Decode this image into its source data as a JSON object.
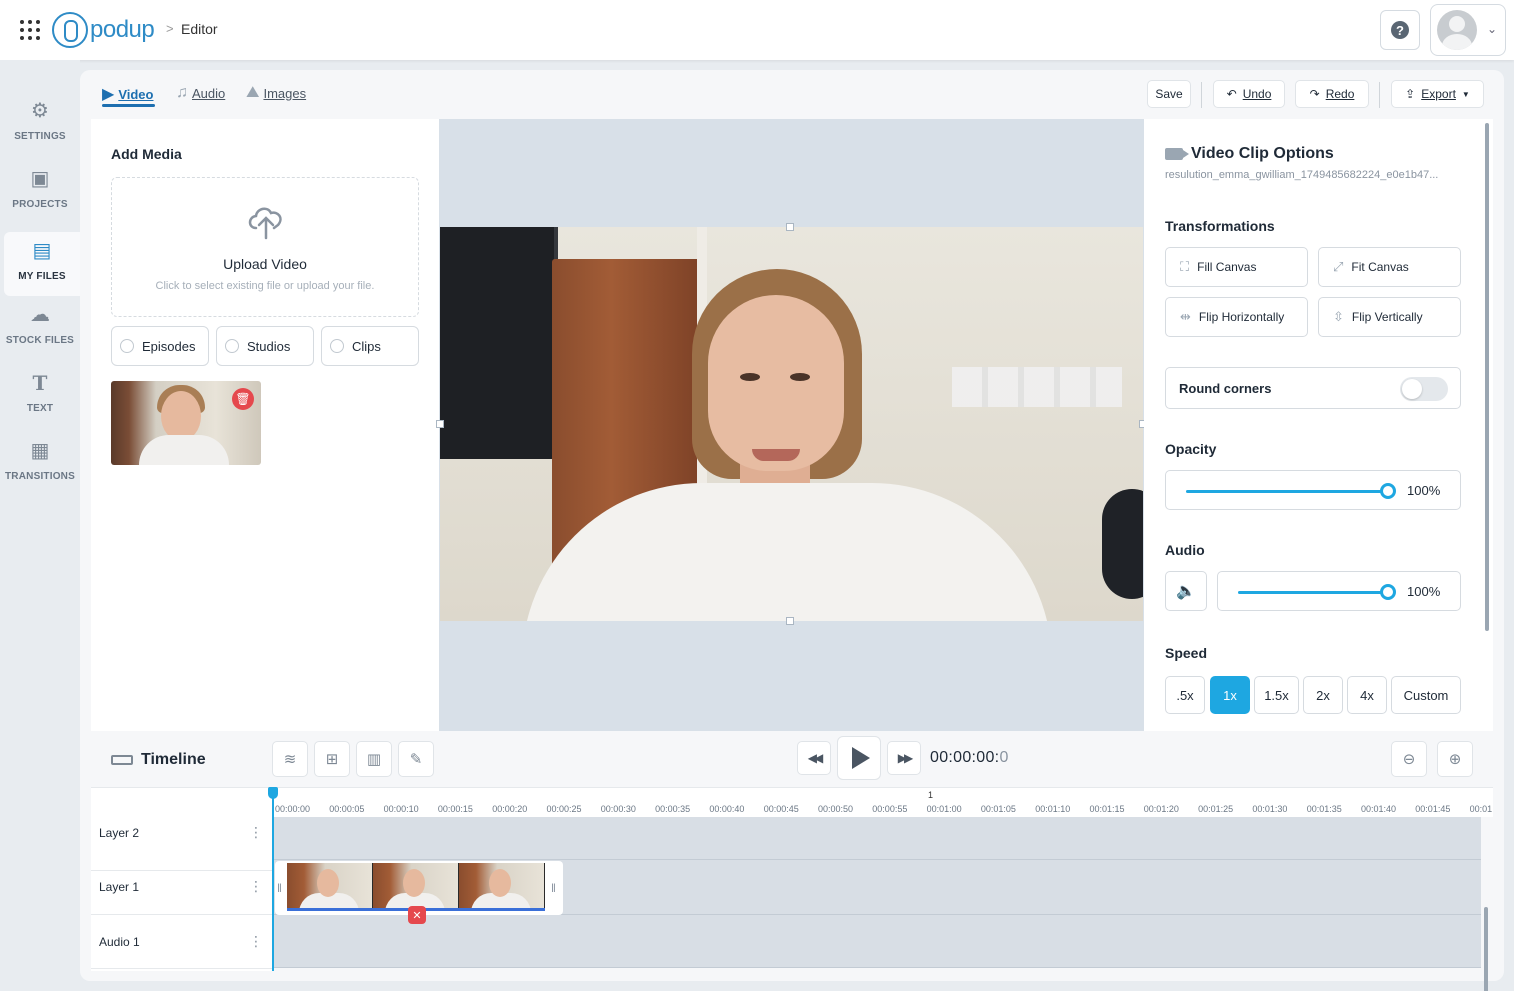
{
  "header": {
    "logo_text": "podup",
    "breadcrumb_sep": ">",
    "breadcrumb": "Editor",
    "help_label": "?"
  },
  "leftnav": {
    "items": [
      {
        "label": "SETTINGS",
        "icon": "gear-icon",
        "glyph": "⚙"
      },
      {
        "label": "PROJECTS",
        "icon": "projects-icon",
        "glyph": "▣"
      },
      {
        "label": "MY FILES",
        "icon": "folder-icon",
        "glyph": "▤",
        "active": true
      },
      {
        "label": "STOCK FILES",
        "icon": "cloud-icon",
        "glyph": "☁"
      },
      {
        "label": "TEXT",
        "icon": "text-icon",
        "glyph": "T"
      },
      {
        "label": "TRANSITIONS",
        "icon": "transitions-icon",
        "glyph": "▦"
      }
    ]
  },
  "tabs": [
    {
      "label": "Video",
      "active": true
    },
    {
      "label": "Audio"
    },
    {
      "label": "Images"
    }
  ],
  "toolbar": {
    "save": "Save",
    "undo": "Undo",
    "redo": "Redo",
    "export": "Export"
  },
  "media": {
    "title": "Add Media",
    "upload_title": "Upload Video",
    "upload_sub": "Click to select existing file or upload your file.",
    "filters": [
      "Episodes",
      "Studios",
      "Clips"
    ]
  },
  "options": {
    "title": "Video Clip Options",
    "filename": "resulution_emma_gwilliam_1749485682224_e0e1b47...",
    "transformations_label": "Transformations",
    "fill_canvas": "Fill Canvas",
    "fit_canvas": "Fit Canvas",
    "flip_h": "Flip Horizontally",
    "flip_v": "Flip Vertically",
    "round_corners": "Round corners",
    "opacity_label": "Opacity",
    "opacity_value": "100%",
    "opacity_level": 1.0,
    "audio_label": "Audio",
    "audio_value": "100%",
    "audio_level": 1.0,
    "speed_label": "Speed",
    "speeds": [
      ".5x",
      "1x",
      "1.5x",
      "2x",
      "4x",
      "Custom"
    ],
    "speed_selected": "1x"
  },
  "timeline": {
    "title": "Timeline",
    "time_main": "00:00:00:",
    "time_frame": "0",
    "ruler_marker": "1",
    "ticks": [
      "00:00:00",
      "00:00:05",
      "00:00:10",
      "00:00:15",
      "00:00:20",
      "00:00:25",
      "00:00:30",
      "00:00:35",
      "00:00:40",
      "00:00:45",
      "00:00:50",
      "00:00:55",
      "00:01:00",
      "00:01:05",
      "00:01:10",
      "00:01:15",
      "00:01:20",
      "00:01:25",
      "00:01:30",
      "00:01:35",
      "00:01:40",
      "00:01:45",
      "00:01"
    ],
    "layers": [
      "Layer 2",
      "Layer 1",
      "Audio 1"
    ]
  },
  "colors": {
    "accent": "#1ea7e1",
    "brand": "#2e8bc6",
    "danger": "#e5484d"
  }
}
